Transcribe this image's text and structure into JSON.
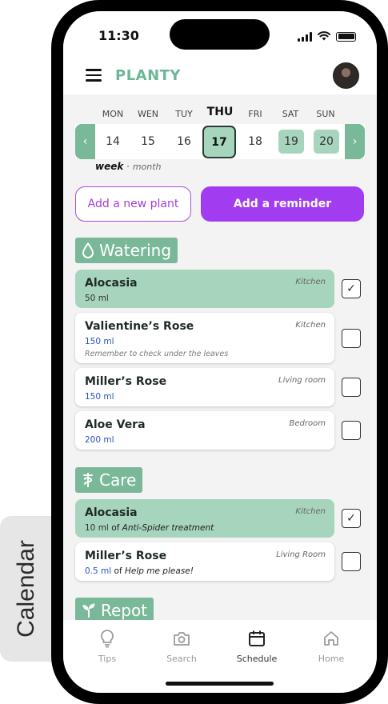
{
  "side_tab": {
    "label": "Calendar"
  },
  "status_bar": {
    "time": "11:30"
  },
  "header": {
    "brand": "PLANTY"
  },
  "calendar": {
    "days": [
      {
        "name": "MON",
        "date": "14",
        "marked": false,
        "today": false
      },
      {
        "name": "WEN",
        "date": "15",
        "marked": false,
        "today": false
      },
      {
        "name": "TUY",
        "date": "16",
        "marked": false,
        "today": false
      },
      {
        "name": "THU",
        "date": "17",
        "marked": true,
        "today": true
      },
      {
        "name": "FRI",
        "date": "18",
        "marked": false,
        "today": false
      },
      {
        "name": "SAT",
        "date": "19",
        "marked": true,
        "today": false
      },
      {
        "name": "SUN",
        "date": "20",
        "marked": true,
        "today": false
      }
    ],
    "prev_icon": "‹",
    "next_icon": "›",
    "view_week": "week",
    "view_separator": "·",
    "view_month": "month"
  },
  "actions": {
    "add_plant": "Add a new plant",
    "add_reminder": "Add a reminder"
  },
  "sections": {
    "watering": {
      "title": "Watering",
      "icon": "water-drop-icon",
      "tasks": [
        {
          "name": "Alocasia",
          "room": "Kitchen",
          "amount": "50 ml",
          "note": "",
          "done": true
        },
        {
          "name": "Valientine’s Rose",
          "room": "Kitchen",
          "amount": "150 ml",
          "note": "Remember to check under the leaves",
          "done": false
        },
        {
          "name": "Miller’s Rose",
          "room": "Living room",
          "amount": "150 ml",
          "note": "",
          "done": false
        },
        {
          "name": "Aloe Vera",
          "room": "Bedroom",
          "amount": "200 ml",
          "note": "",
          "done": false
        }
      ]
    },
    "care": {
      "title": "Care",
      "icon": "caduceus-icon",
      "tasks": [
        {
          "name": "Alocasia",
          "room": "Kitchen",
          "amount": "10 ml",
          "of": " of ",
          "product": "Anti-Spider treatment",
          "done": true
        },
        {
          "name": "Miller’s Rose",
          "room": "Living Room",
          "amount": "0.5 ml",
          "of": " of ",
          "product": "Help me please!",
          "done": false
        }
      ]
    },
    "repot": {
      "title": "Repot",
      "icon": "sprout-icon"
    }
  },
  "check_glyph": "✓",
  "bottom_nav": [
    {
      "label": "Tips",
      "icon": "lightbulb-icon",
      "active": false
    },
    {
      "label": "Search",
      "icon": "camera-icon",
      "active": false
    },
    {
      "label": "Schedule",
      "icon": "calendar-icon",
      "active": true
    },
    {
      "label": "Home",
      "icon": "home-icon",
      "active": false
    }
  ],
  "colors": {
    "brand": "#6cb796",
    "section_green": "#79b898",
    "done_green": "#a6d4bc",
    "accent_purple": "#a23cf0",
    "amount_blue": "#2a52c4"
  }
}
